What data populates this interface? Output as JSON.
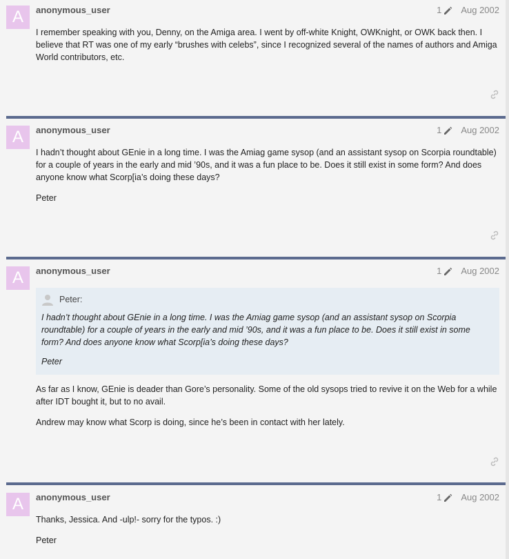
{
  "posts": [
    {
      "avatar_letter": "A",
      "username": "anonymous_user",
      "edits": "1",
      "date": "Aug 2002",
      "paragraphs": [
        "I remember speaking with you, Denny, on the Amiga area. I went by off-white Knight, OWKnight, or OWK back then. I believe that RT was one of my early “brushes with celebs”, since I recognized several of the names of authors and Amiga World contributors, etc."
      ]
    },
    {
      "avatar_letter": "A",
      "username": "anonymous_user",
      "edits": "1",
      "date": "Aug 2002",
      "paragraphs": [
        "I hadn’t thought about GEnie in a long time. I was the Amiag game sysop (and an assistant sysop on Scorpia roundtable) for a couple of years in the early and mid ’90s, and it was a fun place to be. Does it still exist in some form? And does anyone know what Scorp[ia’s doing these days?",
        "Peter"
      ]
    },
    {
      "avatar_letter": "A",
      "username": "anonymous_user",
      "edits": "1",
      "date": "Aug 2002",
      "quote": {
        "author": "Peter:",
        "paragraphs": [
          "I hadn’t thought about GEnie in a long time. I was the Amiag game sysop (and an assistant sysop on Scorpia roundtable) for a couple of years in the early and mid ’90s, and it was a fun place to be. Does it still exist in some form? And does anyone know what Scorp[ia’s doing these days?",
          "Peter"
        ]
      },
      "paragraphs": [
        "As far as I know, GEnie is deader than Gore’s personality. Some of the old sysops tried to revive it on the Web for a while after IDT bought it, but to no avail.",
        "Andrew may know what Scorp is doing, since he’s been in contact with her lately."
      ]
    },
    {
      "avatar_letter": "A",
      "username": "anonymous_user",
      "edits": "1",
      "date": "Aug 2002",
      "paragraphs": [
        "Thanks, Jessica. And -ulp!- sorry for the typos. :)",
        "Peter"
      ]
    }
  ],
  "colors": {
    "avatar_bg": "#e8c5ec",
    "separator": "#5b6a8e",
    "quote_bg": "#e6edf3",
    "page_bg": "#f4f4f4"
  },
  "icons": [
    "pencil-icon",
    "link-icon",
    "quote-avatar-icon"
  ]
}
